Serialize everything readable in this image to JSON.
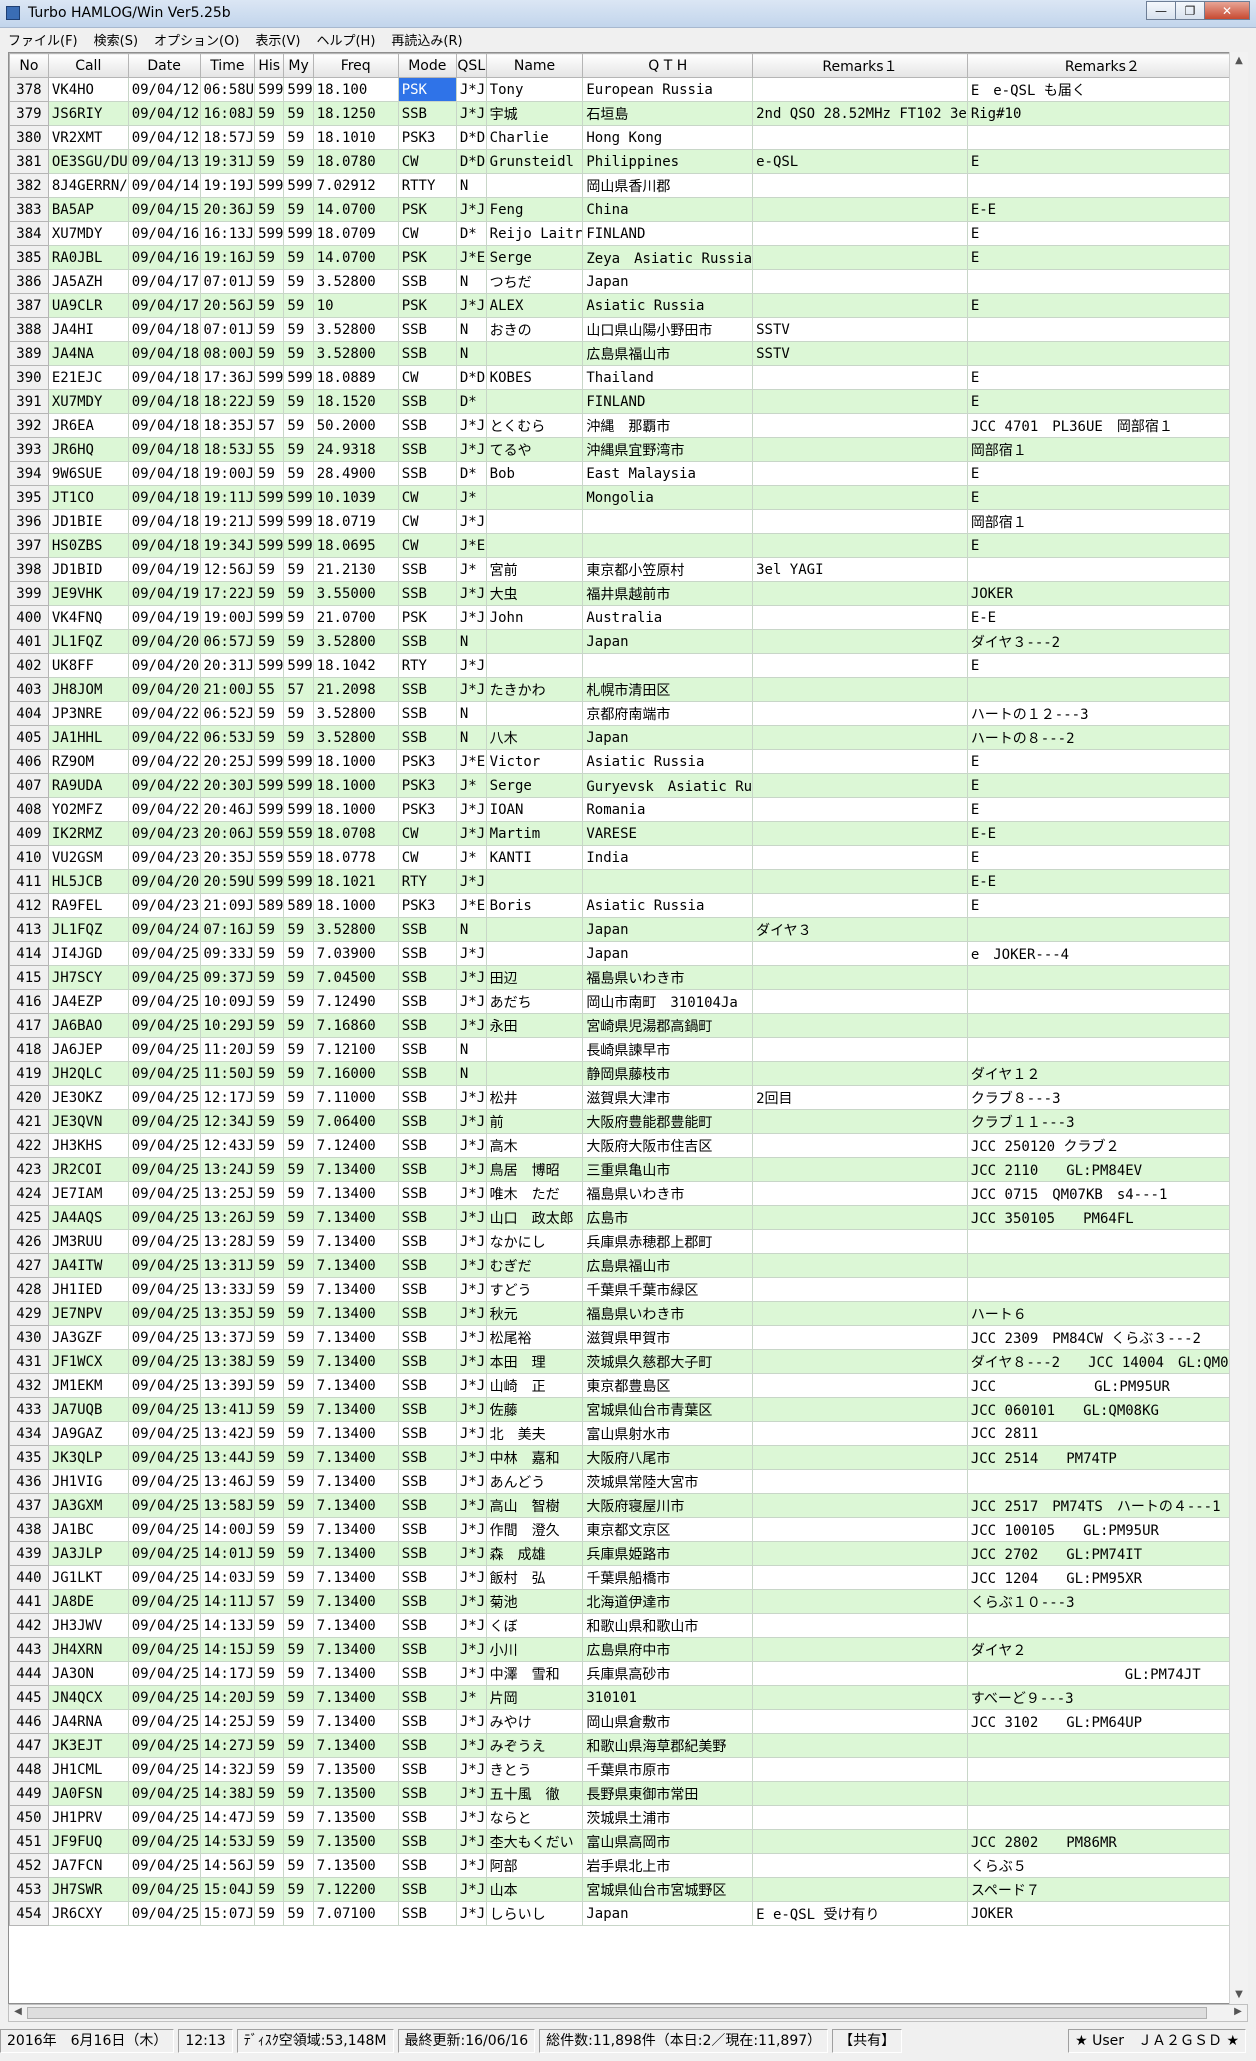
{
  "window": {
    "title": "Turbo HAMLOG/Win Ver5.25b"
  },
  "menu": [
    "ファイル(F)",
    "検索(S)",
    "オプション(O)",
    "表示(V)",
    "ヘルプ(H)",
    "再読込み(R)"
  ],
  "columns": [
    "No",
    "Call",
    "Date",
    "Time",
    "His",
    "My",
    "Freq",
    "Mode",
    "QSL",
    "Name",
    "Q T H",
    "Remarks１",
    "Remarks２"
  ],
  "rows": [
    [
      "378",
      "VK4HO",
      "09/04/12",
      "06:58U",
      "599",
      "599",
      "18.100",
      "PSK",
      "J*J",
      "Tony",
      "European Russia",
      "",
      "E　e-QSL も届く"
    ],
    [
      "379",
      "JS6RIY",
      "09/04/12",
      "16:08J",
      "59",
      "59",
      "18.1250",
      "SSB",
      "J*J",
      "宇城",
      "石垣島",
      "2nd QSO 28.52MHz FT102 3e",
      "Rig#10"
    ],
    [
      "380",
      "VR2XMT",
      "09/04/12",
      "18:57J",
      "59",
      "59",
      "18.1010",
      "PSK3",
      "D*D",
      "Charlie",
      "Hong Kong",
      "",
      ""
    ],
    [
      "381",
      "OE3SGU/DU",
      "09/04/13",
      "19:31J",
      "59",
      "59",
      "18.0780",
      "CW",
      "D*D",
      "Grunsteidl",
      "Philippines",
      "e-QSL",
      "E"
    ],
    [
      "382",
      "8J4GERRN/",
      "09/04/14",
      "19:19J",
      "599",
      "599",
      "7.02912",
      "RTTY",
      "N",
      "",
      "岡山県香川郡",
      "",
      ""
    ],
    [
      "383",
      "BA5AP",
      "09/04/15",
      "20:36J",
      "59",
      "59",
      "14.0700",
      "PSK",
      "J*J",
      "Feng",
      "China",
      "",
      "E-E"
    ],
    [
      "384",
      "XU7MDY",
      "09/04/16",
      "16:13J",
      "599",
      "599",
      "18.0709",
      "CW",
      "D*",
      "Reijo Laitr",
      "FINLAND",
      "",
      "E"
    ],
    [
      "385",
      "RA0JBL",
      "09/04/16",
      "19:16J",
      "59",
      "59",
      "14.0700",
      "PSK",
      "J*E",
      "Serge",
      "Zeya　Asiatic Russia",
      "",
      "E"
    ],
    [
      "386",
      "JA5AZH",
      "09/04/17",
      "07:01J",
      "59",
      "59",
      "3.52800",
      "SSB",
      "N",
      "つちだ",
      "Japan",
      "",
      ""
    ],
    [
      "387",
      "UA9CLR",
      "09/04/17",
      "20:56J",
      "59",
      "59",
      "10",
      "PSK",
      "J*J",
      "ALEX",
      "Asiatic Russia",
      "",
      "E"
    ],
    [
      "388",
      "JA4HI",
      "09/04/18",
      "07:01J",
      "59",
      "59",
      "3.52800",
      "SSB",
      "N",
      "おきの",
      "山口県山陽小野田市",
      "SSTV",
      ""
    ],
    [
      "389",
      "JA4NA",
      "09/04/18",
      "08:00J",
      "59",
      "59",
      "3.52800",
      "SSB",
      "N",
      "",
      "広島県福山市",
      "SSTV",
      ""
    ],
    [
      "390",
      "E21EJC",
      "09/04/18",
      "17:36J",
      "599",
      "599",
      "18.0889",
      "CW",
      "D*D",
      "KOBES",
      "Thailand",
      "",
      "E"
    ],
    [
      "391",
      "XU7MDY",
      "09/04/18",
      "18:22J",
      "59",
      "59",
      "18.1520",
      "SSB",
      "D*",
      "",
      "FINLAND",
      "",
      "E"
    ],
    [
      "392",
      "JR6EA",
      "09/04/18",
      "18:35J",
      "57",
      "59",
      "50.2000",
      "SSB",
      "J*J",
      "とくむら",
      "沖縄　那覇市",
      "",
      "JCC 4701　PL36UE　岡部宿１"
    ],
    [
      "393",
      "JR6HQ",
      "09/04/18",
      "18:53J",
      "55",
      "59",
      "24.9318",
      "SSB",
      "J*J",
      "てるや",
      "沖縄県宜野湾市",
      "",
      "岡部宿１"
    ],
    [
      "394",
      "9W6SUE",
      "09/04/18",
      "19:00J",
      "59",
      "59",
      "28.4900",
      "SSB",
      "D*",
      "Bob",
      "East Malaysia",
      "",
      "E"
    ],
    [
      "395",
      "JT1CO",
      "09/04/18",
      "19:11J",
      "599",
      "599",
      "10.1039",
      "CW",
      "J*",
      "",
      "Mongolia",
      "",
      "E"
    ],
    [
      "396",
      "JD1BIE",
      "09/04/18",
      "19:21J",
      "599",
      "599",
      "18.0719",
      "CW",
      "J*J",
      "",
      "",
      "",
      "岡部宿１"
    ],
    [
      "397",
      "HS0ZBS",
      "09/04/18",
      "19:34J",
      "599",
      "599",
      "18.0695",
      "CW",
      "J*E",
      "",
      "",
      "",
      "E"
    ],
    [
      "398",
      "JD1BID",
      "09/04/19",
      "12:56J",
      "59",
      "59",
      "21.2130",
      "SSB",
      "J*",
      "宮前",
      "東京都小笠原村",
      "3el YAGI",
      ""
    ],
    [
      "399",
      "JE9VHK",
      "09/04/19",
      "17:22J",
      "59",
      "59",
      "3.55000",
      "SSB",
      "J*J",
      "大虫",
      "福井県越前市",
      "",
      "JOKER"
    ],
    [
      "400",
      "VK4FNQ",
      "09/04/19",
      "19:00J",
      "599",
      "59",
      "21.0700",
      "PSK",
      "J*J",
      "John",
      "Australia",
      "",
      "E-E"
    ],
    [
      "401",
      "JL1FQZ",
      "09/04/20",
      "06:57J",
      "59",
      "59",
      "3.52800",
      "SSB",
      "N",
      "",
      "Japan",
      "",
      "ダイヤ３---2"
    ],
    [
      "402",
      "UK8FF",
      "09/04/20",
      "20:31J",
      "599",
      "599",
      "18.1042",
      "RTY",
      "J*J",
      "",
      "",
      "",
      "E"
    ],
    [
      "403",
      "JH8JOM",
      "09/04/20",
      "21:00J",
      "55",
      "57",
      "21.2098",
      "SSB",
      "J*J",
      "たきかわ",
      "札幌市清田区",
      "",
      ""
    ],
    [
      "404",
      "JP3NRE",
      "09/04/22",
      "06:52J",
      "59",
      "59",
      "3.52800",
      "SSB",
      "N",
      "",
      "京都府南端市",
      "",
      "ハートの１２---3"
    ],
    [
      "405",
      "JA1HHL",
      "09/04/22",
      "06:53J",
      "59",
      "59",
      "3.52800",
      "SSB",
      "N",
      "八木",
      "Japan",
      "",
      "ハートの８---2"
    ],
    [
      "406",
      "RZ9OM",
      "09/04/22",
      "20:25J",
      "599",
      "599",
      "18.1000",
      "PSK3",
      "J*E",
      "Victor",
      "Asiatic Russia",
      "",
      "E"
    ],
    [
      "407",
      "RA9UDA",
      "09/04/22",
      "20:30J",
      "599",
      "599",
      "18.1000",
      "PSK3",
      "J*",
      "Serge",
      "Guryevsk　Asiatic Ru",
      "",
      "E"
    ],
    [
      "408",
      "YO2MFZ",
      "09/04/22",
      "20:46J",
      "599",
      "599",
      "18.1000",
      "PSK3",
      "J*J",
      "IOAN",
      "Romania",
      "",
      "E"
    ],
    [
      "409",
      "IK2RMZ",
      "09/04/23",
      "20:06J",
      "559",
      "559",
      "18.0708",
      "CW",
      "J*J",
      "Martim",
      "VARESE",
      "",
      "E-E"
    ],
    [
      "410",
      "VU2GSM",
      "09/04/23",
      "20:35J",
      "559",
      "559",
      "18.0778",
      "CW",
      "J*",
      "KANTI",
      "India",
      "",
      "E"
    ],
    [
      "411",
      "HL5JCB",
      "09/04/20",
      "20:59U",
      "599",
      "599",
      "18.1021",
      "RTY",
      "J*J",
      "",
      "",
      "",
      "E-E"
    ],
    [
      "412",
      "RA9FEL",
      "09/04/23",
      "21:09J",
      "589",
      "589",
      "18.1000",
      "PSK3",
      "J*E",
      "Boris",
      "Asiatic Russia",
      "",
      "E"
    ],
    [
      "413",
      "JL1FQZ",
      "09/04/24",
      "07:16J",
      "59",
      "59",
      "3.52800",
      "SSB",
      "N",
      "",
      "Japan",
      "ダイヤ３",
      ""
    ],
    [
      "414",
      "JI4JGD",
      "09/04/25",
      "09:33J",
      "59",
      "59",
      "7.03900",
      "SSB",
      "J*J",
      "",
      "Japan",
      "",
      "e　JOKER---4"
    ],
    [
      "415",
      "JH7SCY",
      "09/04/25",
      "09:37J",
      "59",
      "59",
      "7.04500",
      "SSB",
      "J*J",
      "田辺",
      "福島県いわき市",
      "",
      ""
    ],
    [
      "416",
      "JA4EZP",
      "09/04/25",
      "10:09J",
      "59",
      "59",
      "7.12490",
      "SSB",
      "J*J",
      "あだち",
      "岡山市南町　310104Ja",
      "",
      ""
    ],
    [
      "417",
      "JA6BAO",
      "09/04/25",
      "10:29J",
      "59",
      "59",
      "7.16860",
      "SSB",
      "J*J",
      "永田",
      "宮崎県児湯郡高鍋町",
      "",
      ""
    ],
    [
      "418",
      "JA6JEP",
      "09/04/25",
      "11:20J",
      "59",
      "59",
      "7.12100",
      "SSB",
      "N",
      "",
      "長崎県諫早市",
      "",
      ""
    ],
    [
      "419",
      "JH2QLC",
      "09/04/25",
      "11:50J",
      "59",
      "59",
      "7.16000",
      "SSB",
      "N",
      "",
      "静岡県藤枝市",
      "",
      "ダイヤ１２"
    ],
    [
      "420",
      "JE3OKZ",
      "09/04/25",
      "12:17J",
      "59",
      "59",
      "7.11000",
      "SSB",
      "J*J",
      "松井",
      "滋賀県大津市",
      "2回目",
      "クラブ８---3"
    ],
    [
      "421",
      "JE3QVN",
      "09/04/25",
      "12:34J",
      "59",
      "59",
      "7.06400",
      "SSB",
      "J*J",
      "前",
      "大阪府豊能郡豊能町",
      "",
      "クラブ１１---3"
    ],
    [
      "422",
      "JH3KHS",
      "09/04/25",
      "12:43J",
      "59",
      "59",
      "7.12400",
      "SSB",
      "J*J",
      "高木",
      "大阪府大阪市住吉区",
      "",
      "JCC 250120 クラブ２"
    ],
    [
      "423",
      "JR2COI",
      "09/04/25",
      "13:24J",
      "59",
      "59",
      "7.13400",
      "SSB",
      "J*J",
      "鳥居　博昭",
      "三重県亀山市",
      "",
      "JCC 2110　　GL:PM84EV"
    ],
    [
      "424",
      "JE7IAM",
      "09/04/25",
      "13:25J",
      "59",
      "59",
      "7.13400",
      "SSB",
      "J*J",
      "唯木　ただ",
      "福島県いわき市",
      "",
      "JCC 0715　QM07KB　s4---1"
    ],
    [
      "425",
      "JA4AQS",
      "09/04/25",
      "13:26J",
      "59",
      "59",
      "7.13400",
      "SSB",
      "J*J",
      "山口　政太郎",
      "広島市",
      "",
      "JCC 350105　　PM64FL"
    ],
    [
      "426",
      "JM3RUU",
      "09/04/25",
      "13:28J",
      "59",
      "59",
      "7.13400",
      "SSB",
      "J*J",
      "なかにし",
      "兵庫県赤穂郡上郡町",
      "",
      ""
    ],
    [
      "427",
      "JA4ITW",
      "09/04/25",
      "13:31J",
      "59",
      "59",
      "7.13400",
      "SSB",
      "J*J",
      "むぎだ",
      "広島県福山市",
      "",
      ""
    ],
    [
      "428",
      "JH1IED",
      "09/04/25",
      "13:33J",
      "59",
      "59",
      "7.13400",
      "SSB",
      "J*J",
      "すどう",
      "千葉県千葉市緑区",
      "",
      ""
    ],
    [
      "429",
      "JE7NPV",
      "09/04/25",
      "13:35J",
      "59",
      "59",
      "7.13400",
      "SSB",
      "J*J",
      "秋元",
      "福島県いわき市",
      "",
      "ハート６"
    ],
    [
      "430",
      "JA3GZF",
      "09/04/25",
      "13:37J",
      "59",
      "59",
      "7.13400",
      "SSB",
      "J*J",
      "松尾裕",
      "滋賀県甲賀市",
      "",
      "JCC 2309　PM84CW くらぶ３---2"
    ],
    [
      "431",
      "JF1WCX",
      "09/04/25",
      "13:38J",
      "59",
      "59",
      "7.13400",
      "SSB",
      "J*J",
      "本田　理",
      "茨城県久慈郡大子町",
      "",
      "ダイヤ８---2　　JCC 14004　GL:QM06"
    ],
    [
      "432",
      "JM1EKM",
      "09/04/25",
      "13:39J",
      "59",
      "59",
      "7.13400",
      "SSB",
      "J*J",
      "山崎　正",
      "東京都豊島区",
      "",
      "JCC　　　　　　　GL:PM95UR"
    ],
    [
      "433",
      "JA7UQB",
      "09/04/25",
      "13:41J",
      "59",
      "59",
      "7.13400",
      "SSB",
      "J*J",
      "佐藤",
      "宮城県仙台市青葉区",
      "",
      "JCC 060101　　GL:QM08KG"
    ],
    [
      "434",
      "JA9GAZ",
      "09/04/25",
      "13:42J",
      "59",
      "59",
      "7.13400",
      "SSB",
      "J*J",
      "北　美夫",
      "富山県射水市",
      "",
      "JCC 2811"
    ],
    [
      "435",
      "JK3QLP",
      "09/04/25",
      "13:44J",
      "59",
      "59",
      "7.13400",
      "SSB",
      "J*J",
      "中林　嘉和",
      "大阪府八尾市",
      "",
      "JCC 2514　　PM74TP"
    ],
    [
      "436",
      "JH1VIG",
      "09/04/25",
      "13:46J",
      "59",
      "59",
      "7.13400",
      "SSB",
      "J*J",
      "あんどう",
      "茨城県常陸大宮市",
      "",
      ""
    ],
    [
      "437",
      "JA3GXM",
      "09/04/25",
      "13:58J",
      "59",
      "59",
      "7.13400",
      "SSB",
      "J*J",
      "高山　智樹",
      "大阪府寝屋川市",
      "",
      "JCC 2517　PM74TS　ハートの４---1"
    ],
    [
      "438",
      "JA1BC",
      "09/04/25",
      "14:00J",
      "59",
      "59",
      "7.13400",
      "SSB",
      "J*J",
      "作間　澄久",
      "東京都文京区",
      "",
      "JCC 100105　　GL:PM95UR"
    ],
    [
      "439",
      "JA3JLP",
      "09/04/25",
      "14:01J",
      "59",
      "59",
      "7.13400",
      "SSB",
      "J*J",
      "森　成雄",
      "兵庫県姫路市",
      "",
      "JCC 2702　　GL:PM74IT"
    ],
    [
      "440",
      "JG1LKT",
      "09/04/25",
      "14:03J",
      "59",
      "59",
      "7.13400",
      "SSB",
      "J*J",
      "飯村　弘",
      "千葉県船橋市",
      "",
      "JCC 1204　　GL:PM95XR"
    ],
    [
      "441",
      "JA8DE",
      "09/04/25",
      "14:11J",
      "57",
      "59",
      "7.13400",
      "SSB",
      "J*J",
      "菊池",
      "北海道伊達市",
      "",
      "くらぶ１０---3"
    ],
    [
      "442",
      "JH3JWV",
      "09/04/25",
      "14:13J",
      "59",
      "59",
      "7.13400",
      "SSB",
      "J*J",
      "くぼ",
      "和歌山県和歌山市",
      "",
      ""
    ],
    [
      "443",
      "JH4XRN",
      "09/04/25",
      "14:15J",
      "59",
      "59",
      "7.13400",
      "SSB",
      "J*J",
      "小川",
      "広島県府中市",
      "",
      "ダイヤ２"
    ],
    [
      "444",
      "JA3ON",
      "09/04/25",
      "14:17J",
      "59",
      "59",
      "7.13400",
      "SSB",
      "J*J",
      "中澤　雪和",
      "兵庫県高砂市",
      "",
      "　　　　　　　　　　　GL:PM74JT"
    ],
    [
      "445",
      "JN4QCX",
      "09/04/25",
      "14:20J",
      "59",
      "59",
      "7.13400",
      "SSB",
      "J*",
      "片岡",
      "310101",
      "",
      "すべーど９---3"
    ],
    [
      "446",
      "JA4RNA",
      "09/04/25",
      "14:25J",
      "59",
      "59",
      "7.13400",
      "SSB",
      "J*J",
      "みやけ",
      "岡山県倉敷市",
      "",
      "JCC 3102　　GL:PM64UP"
    ],
    [
      "447",
      "JK3EJT",
      "09/04/25",
      "14:27J",
      "59",
      "59",
      "7.13400",
      "SSB",
      "J*J",
      "みぞうえ",
      "和歌山県海草郡紀美野",
      "",
      ""
    ],
    [
      "448",
      "JH1CML",
      "09/04/25",
      "14:32J",
      "59",
      "59",
      "7.13500",
      "SSB",
      "J*J",
      "きとう",
      "千葉県市原市",
      "",
      ""
    ],
    [
      "449",
      "JA0FSN",
      "09/04/25",
      "14:38J",
      "59",
      "59",
      "7.13500",
      "SSB",
      "J*J",
      "五十風　徹",
      "長野県東御市常田",
      "",
      ""
    ],
    [
      "450",
      "JH1PRV",
      "09/04/25",
      "14:47J",
      "59",
      "59",
      "7.13500",
      "SSB",
      "J*J",
      "ならと",
      "茨城県土浦市",
      "",
      ""
    ],
    [
      "451",
      "JF9FUQ",
      "09/04/25",
      "14:53J",
      "59",
      "59",
      "7.13500",
      "SSB",
      "J*J",
      "杢大もくだい",
      "富山県高岡市",
      "",
      "JCC 2802　　PM86MR"
    ],
    [
      "452",
      "JA7FCN",
      "09/04/25",
      "14:56J",
      "59",
      "59",
      "7.13500",
      "SSB",
      "J*J",
      "阿部",
      "岩手県北上市",
      "",
      "くらぶ５"
    ],
    [
      "453",
      "JH7SWR",
      "09/04/25",
      "15:04J",
      "59",
      "59",
      "7.12200",
      "SSB",
      "J*J",
      "山本",
      "宮城県仙台市宮城野区",
      "",
      "スペード７"
    ],
    [
      "454",
      "JR6CXY",
      "09/04/25",
      "15:07J",
      "59",
      "59",
      "7.07100",
      "SSB",
      "J*J",
      "しらいし",
      "Japan",
      "E e-QSL 受け有り",
      "JOKER"
    ]
  ],
  "status": {
    "date": "2016年　6月16日（木）",
    "time": "12:13",
    "disk": "ﾃﾞｨｽｸ空領域:53,148M",
    "updated": "最終更新:16/06/16",
    "total": "総件数:11,898件（本日:2／現在:11,897）",
    "shared": "【共有】",
    "user": "★ User　ＪＡ２ＧＳＤ ★"
  },
  "selected_cell": {
    "row": 0,
    "col": 7
  },
  "colors": {
    "row_alt": "#dcf7d6",
    "selection": "#2f73e8"
  }
}
